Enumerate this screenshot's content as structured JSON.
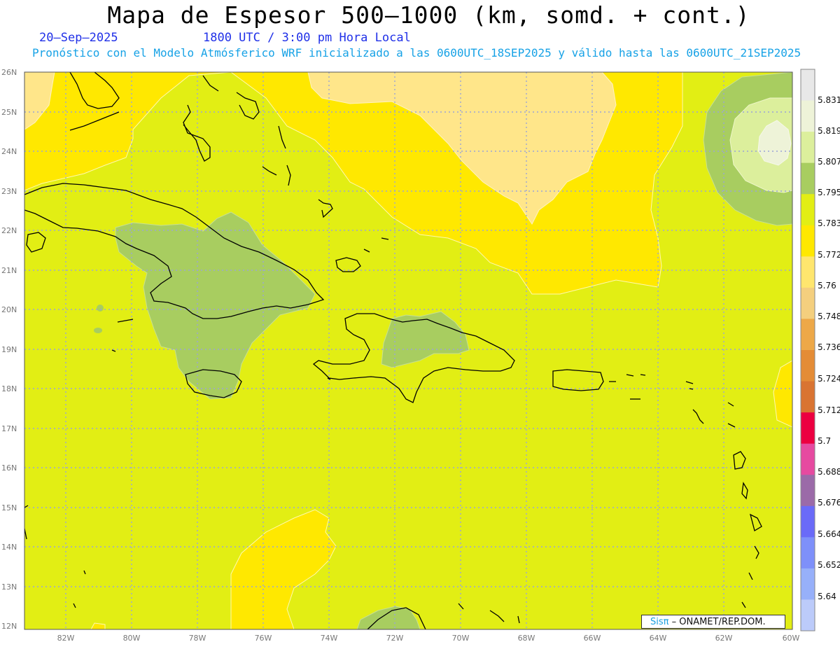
{
  "header": {
    "title": "Mapa de Espesor 500–1000 (km, somd. + cont.)",
    "date": "20–Sep–2025",
    "time": "1800 UTC / 3:00 pm Hora Local",
    "forecast": "Pronóstico con el Modelo Atmósferico WRF inicializado a las 0600UTC_18SEP2025 y válido hasta las  0600UTC_21SEP2025"
  },
  "axes": {
    "lat_labels": [
      "26N",
      "25N",
      "24N",
      "23N",
      "22N",
      "21N",
      "20N",
      "19N",
      "18N",
      "17N",
      "16N",
      "15N",
      "14N",
      "13N",
      "12N"
    ],
    "lon_labels": [
      "82W",
      "80W",
      "78W",
      "76W",
      "74W",
      "72W",
      "70W",
      "68W",
      "66W",
      "64W",
      "62W",
      "60W"
    ]
  },
  "colorbar": {
    "labels": [
      "5.831",
      "5.819",
      "5.807",
      "5.795",
      "5.783",
      "5.772",
      "5.76",
      "5.748",
      "5.736",
      "5.724",
      "5.712",
      "5.7",
      "5.688",
      "5.676",
      "5.664",
      "5.652",
      "5.64"
    ],
    "colors": [
      "#e8e8e8",
      "#eef3d8",
      "#dcef9c",
      "#a8cd60",
      "#e2ee14",
      "#ffe800",
      "#ffe66e",
      "#f4cf7e",
      "#eda848",
      "#e48c36",
      "#d97432",
      "#ec0040",
      "#e64aa0",
      "#9b6aa8",
      "#6a6af8",
      "#7e90fa",
      "#97b0fa",
      "#bccbfa"
    ]
  },
  "fill_colors": {
    "base": "#e2ee14",
    "yellow": "#ffe800",
    "pale": "#ffe68a",
    "green": "#a8cd60",
    "lightgreen": "#dcef9c",
    "palest": "#eef3d8"
  },
  "footer": {
    "brand": "Sisπ",
    "credit": " – ONAMET/REP.DOM."
  }
}
